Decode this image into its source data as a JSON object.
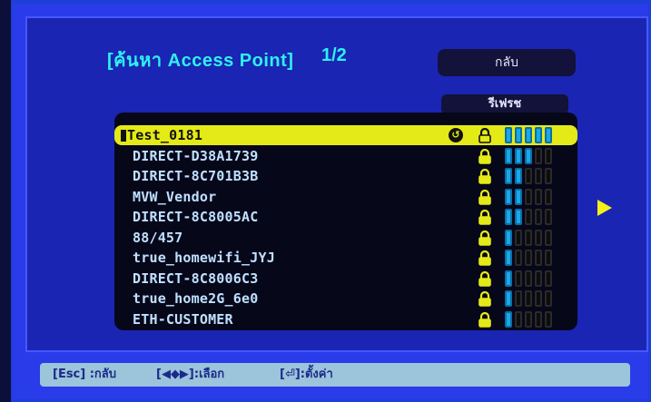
{
  "header": {
    "title": "[ค้นหา Access Point]",
    "page_indicator": "1/2",
    "back_label": "กลับ"
  },
  "list": {
    "column_header": "รีเฟรช",
    "rows": [
      {
        "ssid": "Test_0181",
        "selected": true,
        "connected": true,
        "signal": 5
      },
      {
        "ssid": "DIRECT-D38A1739",
        "selected": false,
        "connected": false,
        "signal": 3
      },
      {
        "ssid": "DIRECT-8C701B3B",
        "selected": false,
        "connected": false,
        "signal": 2
      },
      {
        "ssid": "MVW_Vendor",
        "selected": false,
        "connected": false,
        "signal": 2
      },
      {
        "ssid": "DIRECT-8C8005AC",
        "selected": false,
        "connected": false,
        "signal": 2
      },
      {
        "ssid": "88/457",
        "selected": false,
        "connected": false,
        "signal": 1
      },
      {
        "ssid": "true_homewifi_JYJ",
        "selected": false,
        "connected": false,
        "signal": 1
      },
      {
        "ssid": "DIRECT-8C8006C3",
        "selected": false,
        "connected": false,
        "signal": 1
      },
      {
        "ssid": "true_home2G_6e0",
        "selected": false,
        "connected": false,
        "signal": 1
      },
      {
        "ssid": "ETH-CUSTOMER",
        "selected": false,
        "connected": false,
        "signal": 1
      }
    ],
    "signal_max": 5
  },
  "next_page_icon": "arrow-right-icon",
  "footer": {
    "esc_hint": "[Esc] :กลับ",
    "select_hint": "[◀◆▶]:เลือก",
    "enter_hint": "[⏎]:ตั้งค่า"
  },
  "colors": {
    "background": "#1d3fd6",
    "selection": "#e4ea18",
    "title": "#2ff0f0",
    "signal_on": "#1aa8e6",
    "lock": "#e4ea18"
  }
}
